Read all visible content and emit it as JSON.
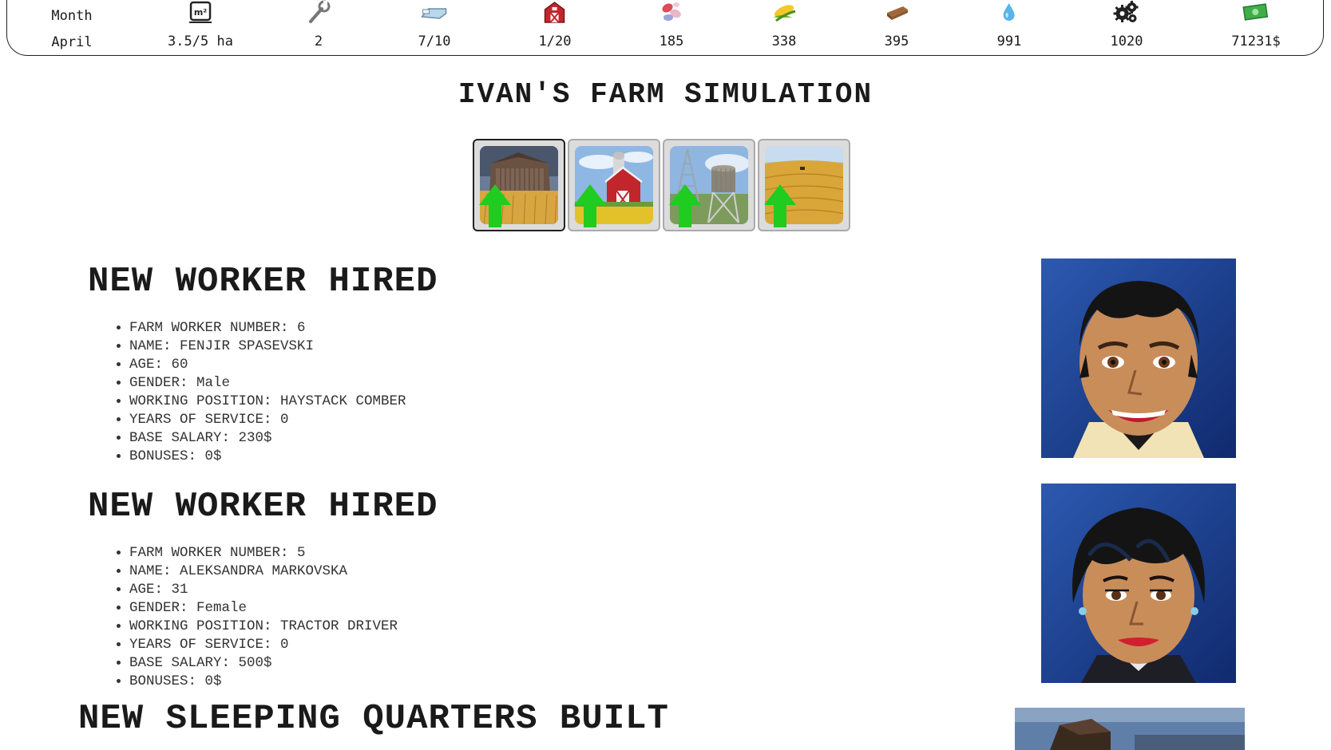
{
  "stats": [
    {
      "id": "month",
      "label": "Month",
      "value": "April",
      "icon": null
    },
    {
      "id": "land",
      "label": "",
      "value": "3.5/5 ha",
      "icon": "area-m2-icon"
    },
    {
      "id": "tools",
      "label": "",
      "value": "2",
      "icon": "wrench-icon"
    },
    {
      "id": "beds",
      "label": "",
      "value": "7/10",
      "icon": "bed-icon"
    },
    {
      "id": "barns",
      "label": "",
      "value": "1/20",
      "icon": "barn-icon"
    },
    {
      "id": "seeds",
      "label": "",
      "value": "185",
      "icon": "seeds-icon"
    },
    {
      "id": "corn",
      "label": "",
      "value": "338",
      "icon": "corn-icon"
    },
    {
      "id": "wood",
      "label": "",
      "value": "395",
      "icon": "wood-icon"
    },
    {
      "id": "water",
      "label": "",
      "value": "991",
      "icon": "water-drop-icon"
    },
    {
      "id": "parts",
      "label": "",
      "value": "1020",
      "icon": "gears-icon"
    },
    {
      "id": "money",
      "label": "",
      "value": "71231$",
      "icon": "money-icon"
    }
  ],
  "title": "IVAN'S FARM SIMULATION",
  "thumbnails": [
    {
      "name": "barn-field-upgrade",
      "active": true
    },
    {
      "name": "red-barn-silo-upgrade",
      "active": false
    },
    {
      "name": "water-tower-upgrade",
      "active": false
    },
    {
      "name": "wheat-field-upgrade",
      "active": false
    }
  ],
  "events": [
    {
      "heading": "NEW WORKER HIRED",
      "portrait": "male-worker-portrait",
      "details": [
        "FARM WORKER NUMBER: 6",
        "NAME: FENJIR SPASEVSKI",
        "AGE: 60",
        "GENDER: Male",
        "WORKING POSITION: HAYSTACK COMBER",
        "YEARS OF SERVICE: 0",
        "BASE SALARY: 230$",
        "BONUSES: 0$"
      ]
    },
    {
      "heading": "NEW WORKER HIRED",
      "portrait": "female-worker-portrait",
      "details": [
        "FARM WORKER NUMBER: 5",
        "NAME: ALEKSANDRA MARKOVSKA",
        "AGE: 31",
        "GENDER: Female",
        "WORKING POSITION: TRACTOR DRIVER",
        "YEARS OF SERVICE: 0",
        "BASE SALARY: 500$",
        "BONUSES: 0$"
      ]
    },
    {
      "heading": "NEW SLEEPING QUARTERS BUILT",
      "portrait": "sleeping-quarters-image",
      "details": []
    }
  ],
  "colors": {
    "upgrade_arrow": "#1fcc1f",
    "portrait_bg": "#1b3a8c",
    "barn_red": "#c0262b"
  }
}
